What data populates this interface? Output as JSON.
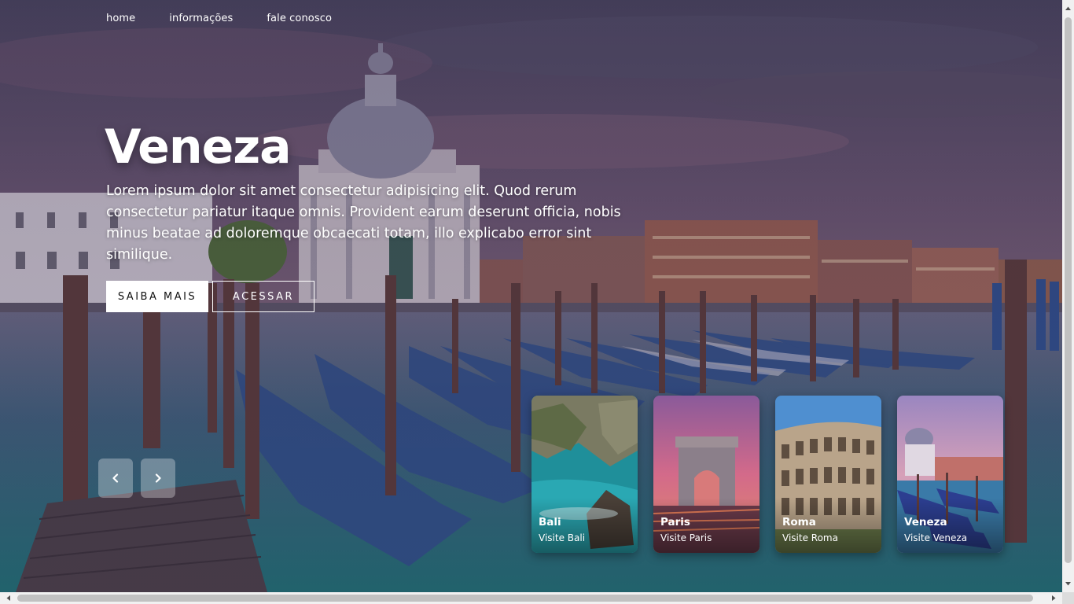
{
  "nav": {
    "items": [
      "home",
      "informações",
      "fale conosco"
    ]
  },
  "hero": {
    "title": "Veneza",
    "description": "Lorem ipsum dolor sit amet consectetur adipisicing elit. Quod rerum consectetur pariatur itaque omnis. Provident earum deserunt officia, nobis minus beatae ad doloremque obcaecati totam, illo explicabo error sint similique.",
    "primary_button": "SAIBA MAIS",
    "secondary_button": "ACESSAR"
  },
  "slider": {
    "prev_icon": "chevron-left-icon",
    "next_icon": "chevron-right-icon"
  },
  "cards": [
    {
      "name": "Bali",
      "subtitle": "Visite Bali"
    },
    {
      "name": "Paris",
      "subtitle": "Visite Paris"
    },
    {
      "name": "Roma",
      "subtitle": "Visite Roma"
    },
    {
      "name": "Veneza",
      "subtitle": "Visite Veneza"
    }
  ],
  "colors": {
    "overlay": "#3c3550",
    "button_primary_bg": "#ffffff",
    "text": "#ffffff"
  }
}
